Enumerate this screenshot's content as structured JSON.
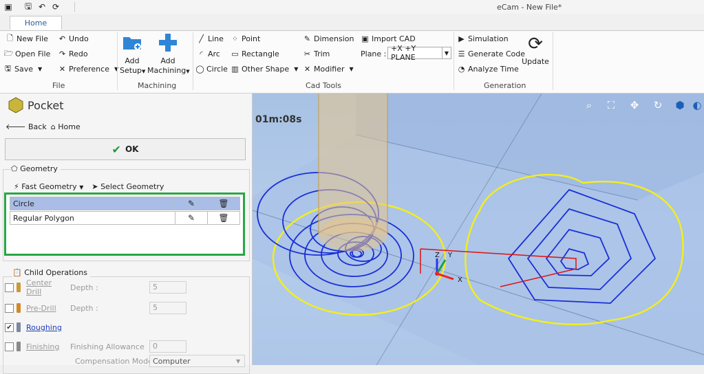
{
  "window": {
    "title": "eCam - New File*"
  },
  "tabs": [
    {
      "label": "Home"
    }
  ],
  "ribbon": {
    "file": {
      "group_label": "File",
      "new_file": "New File",
      "open_file": "Open File",
      "save": "Save",
      "undo": "Undo",
      "redo": "Redo",
      "preference": "Preference"
    },
    "machining": {
      "group_label": "Machining",
      "add_setup_line1": "Add",
      "add_setup_line2": "Setup",
      "add_machining_line1": "Add",
      "add_machining_line2": "Machining"
    },
    "cad_tools": {
      "group_label": "Cad Tools",
      "line": "Line",
      "arc": "Arc",
      "circle": "Circle",
      "point": "Point",
      "rectangle": "Rectangle",
      "other_shape": "Other Shape",
      "dimension": "Dimension",
      "trim": "Trim",
      "modifier": "Modifier",
      "import_cad": "Import CAD",
      "plane_label": "Plane :",
      "plane_value": "+X +Y PLANE"
    },
    "generation": {
      "group_label": "Generation",
      "simulation": "Simulation",
      "generate_code": "Generate Code",
      "analyze_time": "Analyze Time",
      "update": "Update"
    }
  },
  "panel": {
    "title": "Pocket",
    "back": "Back",
    "home": "Home",
    "ok": "OK",
    "geometry_legend": "Geometry",
    "fast_geometry": "Fast Geometry",
    "select_geometry": "Select Geometry",
    "geometry_items": [
      {
        "name": "Circle",
        "selected": true
      },
      {
        "name": "Regular Polygon",
        "selected": false
      }
    ],
    "child_ops_legend": "Child Operations",
    "operations": [
      {
        "name": "Center Drill",
        "checked": false,
        "param_label": "Depth :",
        "param_value": "5"
      },
      {
        "name": "Pre-Drill",
        "checked": false,
        "param_label": "Depth :",
        "param_value": "5"
      },
      {
        "name": "Roughing",
        "checked": true
      },
      {
        "name": "Finishing",
        "checked": false,
        "param_label": "Finishing Allowance",
        "param_value": "0"
      }
    ],
    "compensation_label": "Compensation Mode",
    "compensation_value": "Computer"
  },
  "viewport": {
    "timer": "01m:08s",
    "axis_x": "X",
    "axis_y": "Y",
    "axis_z": "Z"
  },
  "colors": {
    "highlight_box": "#28a745",
    "selected_row": "#a9bde6",
    "toolpath": "#1a2ed6",
    "boundary": "#f2ee1e",
    "viewport_bg": "#b3cbeb"
  }
}
